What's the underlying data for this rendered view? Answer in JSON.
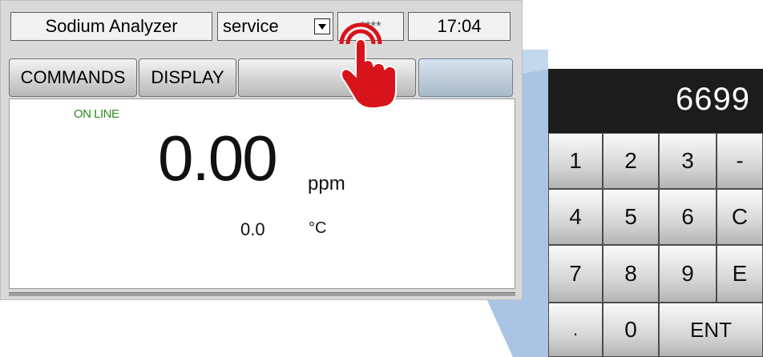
{
  "header": {
    "title": "Sodium Analyzer",
    "mode_value": "service",
    "password_mask": "****",
    "time": "17:04"
  },
  "toolbar": {
    "commands_label": "COMMANDS",
    "display_label": "DISPLAY"
  },
  "readout": {
    "status": "ON LINE",
    "value": "0.00",
    "unit": "ppm",
    "temperature": "0.0",
    "temperature_unit": "°C"
  },
  "keypad": {
    "display_value": "6699",
    "keys": [
      "1",
      "2",
      "3",
      "-",
      "4",
      "5",
      "6",
      "C",
      "7",
      "8",
      "9",
      "E",
      ".",
      "0",
      "ENT"
    ]
  },
  "icons": {
    "dropdown": "chevron-down-icon",
    "pointer": "tap-hand-icon"
  },
  "colors": {
    "status_green": "#2e8b1f",
    "hand_red": "#d7141c",
    "zoom_blue": "#a9c4e4",
    "keypad_display_bg": "#1c1c1c"
  }
}
